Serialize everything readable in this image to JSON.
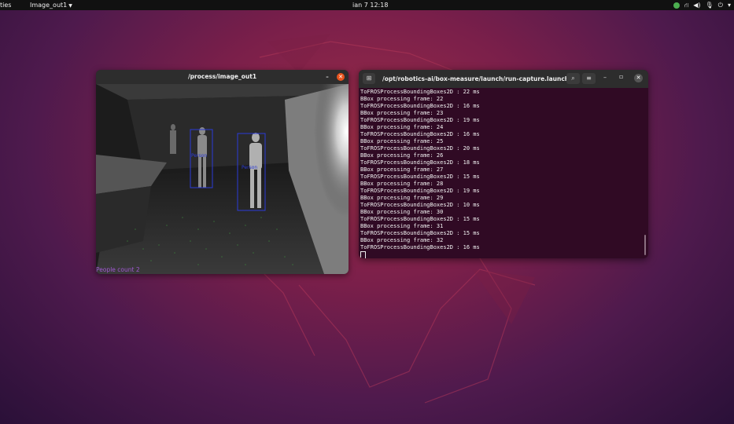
{
  "topbar": {
    "activities": "ties",
    "app_menu": "Image_out1",
    "clock": "ian 7  12:18"
  },
  "image_window": {
    "title": "/process/image_out1",
    "people_count": "People count 2",
    "detections": [
      {
        "label": "Person"
      },
      {
        "label": "Person"
      }
    ]
  },
  "terminal": {
    "title": "/opt/robotics-ai/box-measure/launch/run-capture.launch ht...",
    "lines": [
      "ToFROSProcessBoundingBoxes2D : 22 ms",
      "BBox processing frame: 22",
      "ToFROSProcessBoundingBoxes2D : 16 ms",
      "BBox processing frame: 23",
      "ToFROSProcessBoundingBoxes2D : 19 ms",
      "BBox processing frame: 24",
      "ToFROSProcessBoundingBoxes2D : 16 ms",
      "BBox processing frame: 25",
      "ToFROSProcessBoundingBoxes2D : 20 ms",
      "BBox processing frame: 26",
      "ToFROSProcessBoundingBoxes2D : 18 ms",
      "BBox processing frame: 27",
      "ToFROSProcessBoundingBoxes2D : 15 ms",
      "BBox processing frame: 28",
      "ToFROSProcessBoundingBoxes2D : 19 ms",
      "BBox processing frame: 29",
      "ToFROSProcessBoundingBoxes2D : 10 ms",
      "BBox processing frame: 30",
      "ToFROSProcessBoundingBoxes2D : 15 ms",
      "BBox processing frame: 31",
      "ToFROSProcessBoundingBoxes2D : 15 ms",
      "BBox processing frame: 32",
      "ToFROSProcessBoundingBoxes2D : 16 ms"
    ]
  },
  "colors": {
    "terminal_bg": "#300a24",
    "close_button": "#e9541e",
    "people_count": "#a259d4",
    "bbox": "#2b3bd8"
  },
  "icons": [
    "terminal-tab-icon",
    "search-icon",
    "hamburger-menu-icon",
    "minimize-icon",
    "maximize-icon",
    "close-icon",
    "network-icon",
    "volume-icon",
    "microphone-icon",
    "power-icon",
    "chevron-down-icon"
  ]
}
